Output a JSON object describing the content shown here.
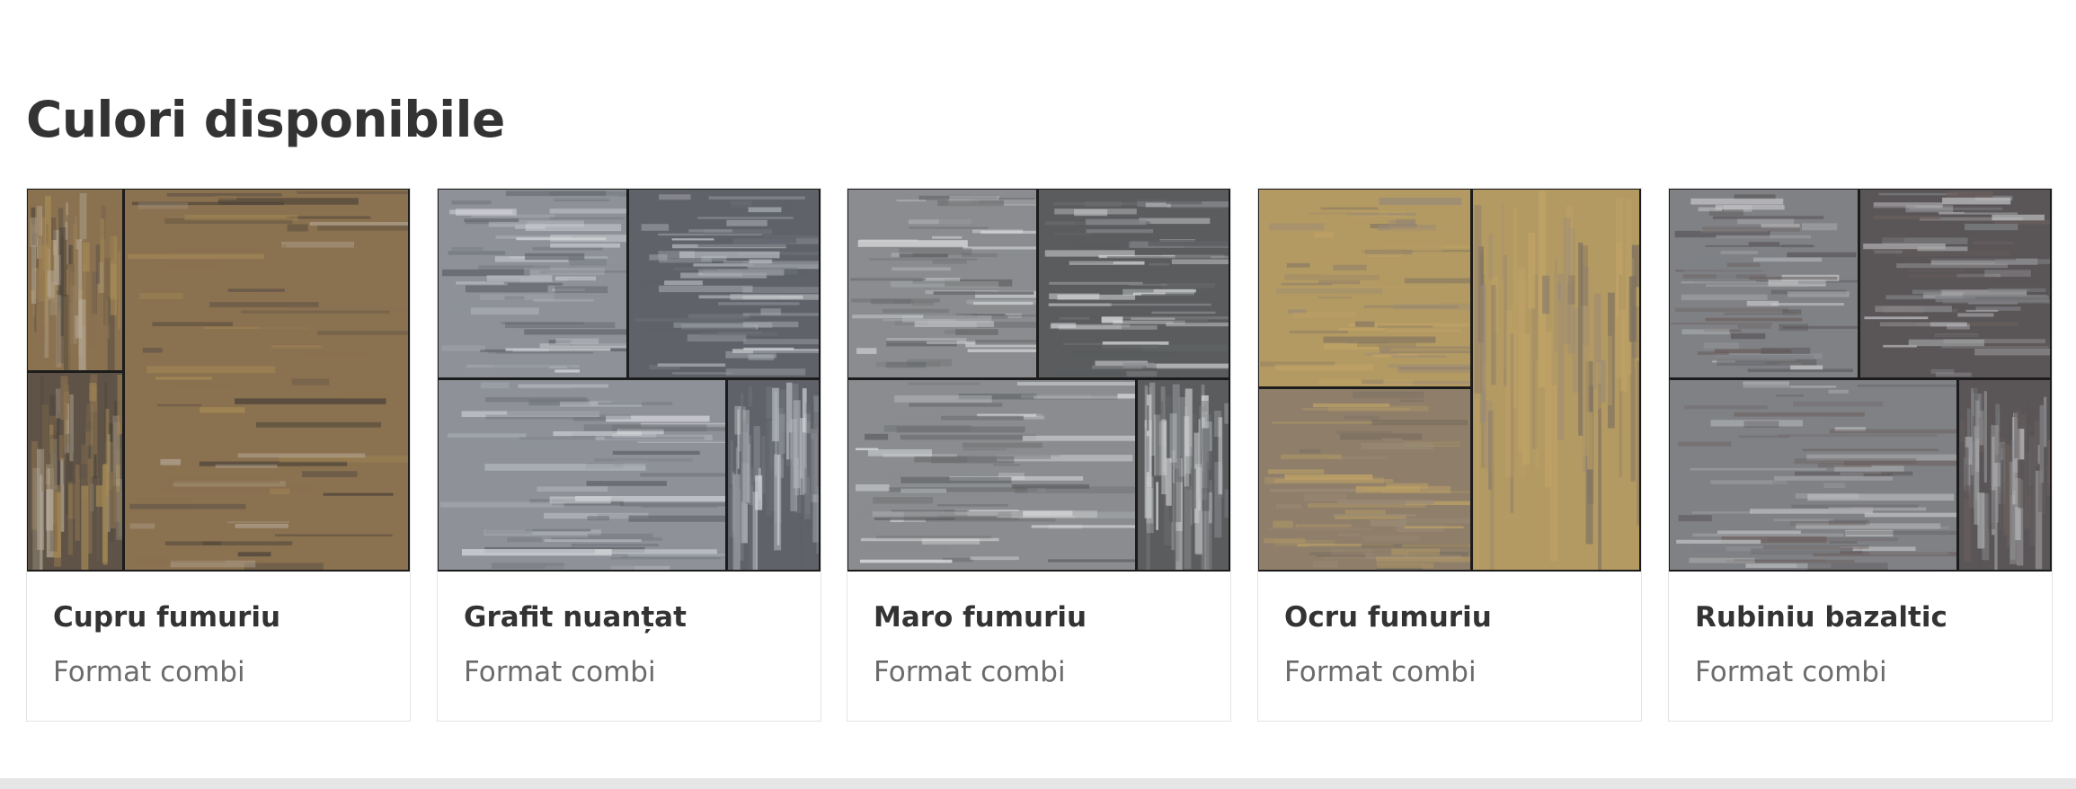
{
  "section": {
    "title": "Culori disponibile"
  },
  "colors": [
    {
      "name": "Cupru fumuriu",
      "format": "Format combi",
      "pattern": "vertical-split",
      "palette": [
        "#8a7150",
        "#5e5346",
        "#a68a55",
        "#b8ad9c",
        "#4a4238"
      ]
    },
    {
      "name": "Grafit nuanțat",
      "format": "Format combi",
      "pattern": "combi-grid",
      "palette": [
        "#8e9298",
        "#5f6268",
        "#b7bbc0",
        "#70747a",
        "#d4d6da"
      ]
    },
    {
      "name": "Maro fumuriu",
      "format": "Format combi",
      "pattern": "combi-grid",
      "palette": [
        "#8a8c8f",
        "#5a5c5e",
        "#c9cbcd",
        "#6e6f70",
        "#e3e4e5"
      ]
    },
    {
      "name": "Ocru fumuriu",
      "format": "Format combi",
      "pattern": "ocher-split",
      "palette": [
        "#b39a63",
        "#8f7f6a",
        "#c2a466",
        "#9a8a77",
        "#7b6f60"
      ]
    },
    {
      "name": "Rubiniu bazaltic",
      "format": "Format combi",
      "pattern": "combi-grid",
      "palette": [
        "#7f8185",
        "#5a5658",
        "#a9aaac",
        "#6b5f5d",
        "#c7c8ca"
      ]
    }
  ]
}
